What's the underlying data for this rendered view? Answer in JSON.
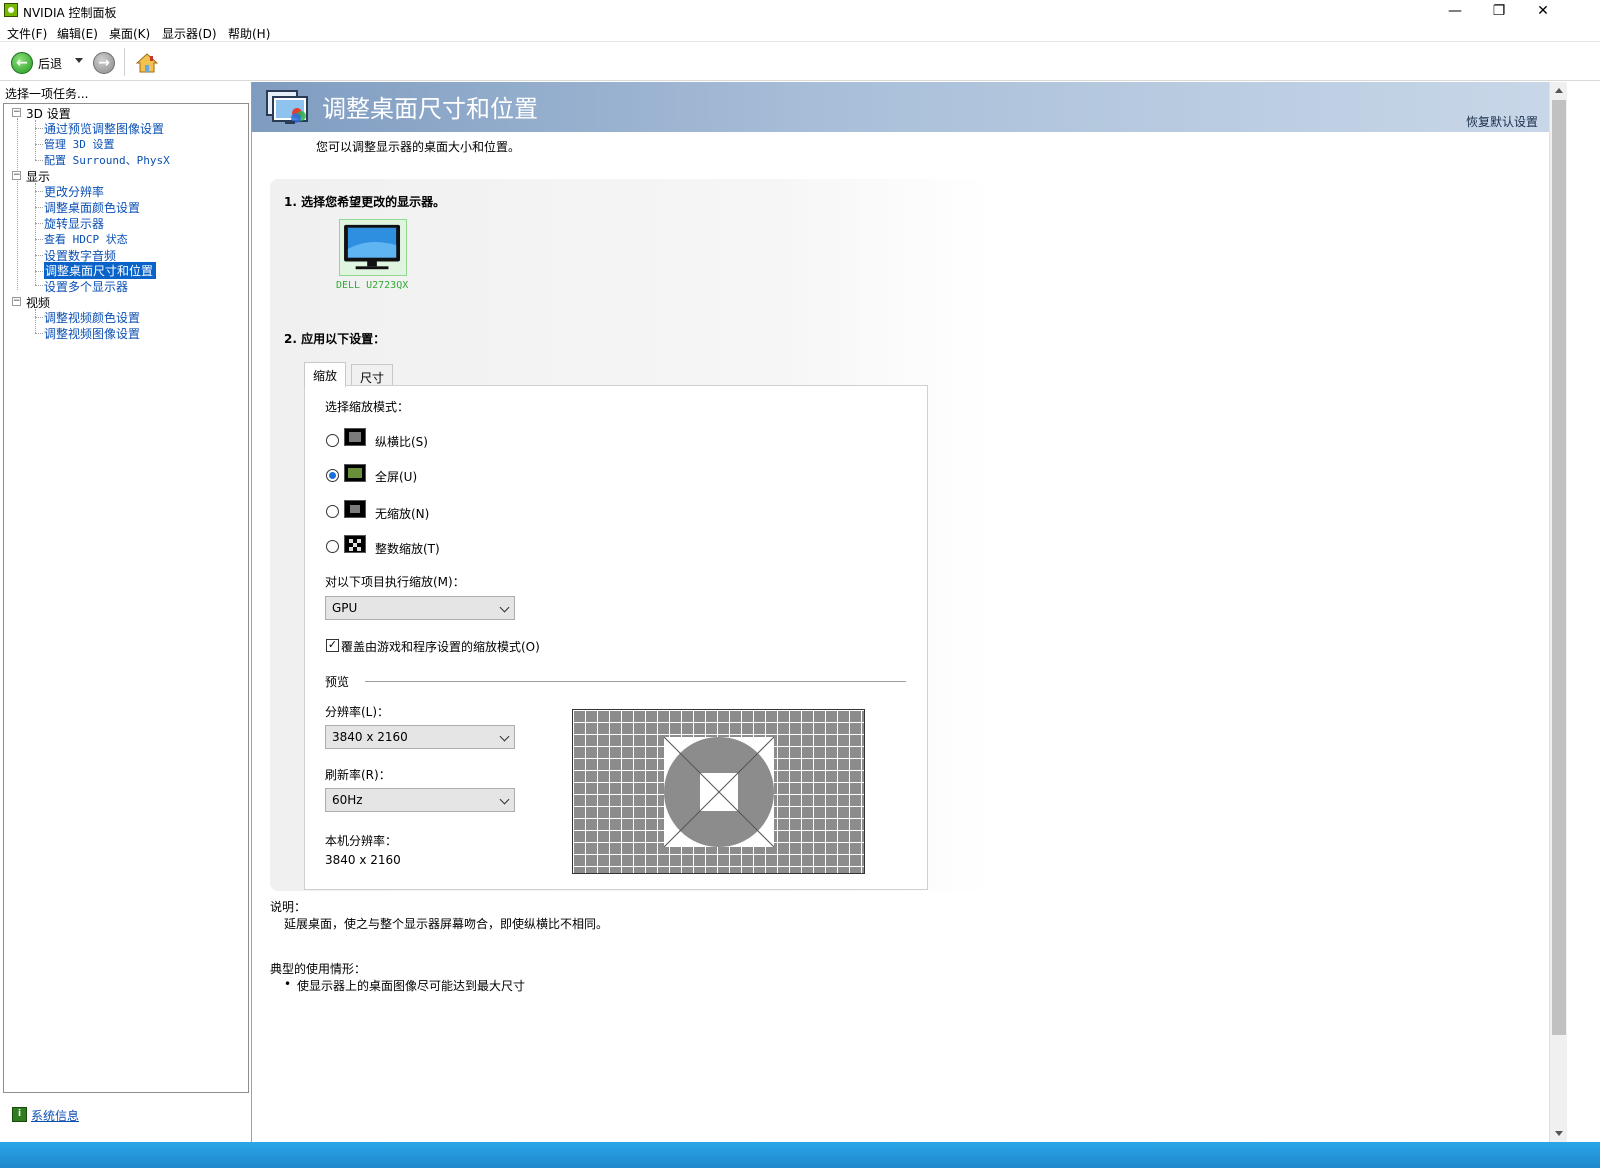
{
  "window": {
    "title": "NVIDIA 控制面板",
    "minimize_glyph": "—",
    "restore_glyph": "❐",
    "close_glyph": "✕"
  },
  "menu": [
    "文件(F)",
    "编辑(E)",
    "桌面(K)",
    "显示器(D)",
    "帮助(H)"
  ],
  "toolbar": {
    "back_label": "后退"
  },
  "sidebar": {
    "header": "选择一项任务...",
    "categories": [
      {
        "label": "3D 设置",
        "items": [
          "通过预览调整图像设置",
          "管理 3D 设置",
          "配置 Surround、PhysX"
        ]
      },
      {
        "label": "显示",
        "items": [
          "更改分辨率",
          "调整桌面颜色设置",
          "旋转显示器",
          "查看 HDCP 状态",
          "设置数字音频",
          "调整桌面尺寸和位置",
          "设置多个显示器"
        ]
      },
      {
        "label": "视频",
        "items": [
          "调整视频颜色设置",
          "调整视频图像设置"
        ]
      }
    ],
    "selected_item": "调整桌面尺寸和位置",
    "system_info_label": "系统信息"
  },
  "page": {
    "title": "调整桌面尺寸和位置",
    "restore_defaults": "恢复默认设置",
    "description": "您可以调整显示器的桌面大小和位置。",
    "step1": "1. 选择您希望更改的显示器。",
    "monitor_name": "DELL U2723QX",
    "step2": "2. 应用以下设置：",
    "tabs": [
      "缩放",
      "尺寸"
    ],
    "active_tab": "缩放",
    "scaling": {
      "mode_label": "选择缩放模式：",
      "modes": [
        {
          "label": "纵横比(S)",
          "checked": false
        },
        {
          "label": "全屏(U)",
          "checked": true
        },
        {
          "label": "无缩放(N)",
          "checked": false
        },
        {
          "label": "整数缩放(T)",
          "checked": false
        }
      ],
      "perform_on_label": "对以下项目执行缩放(M)：",
      "perform_on_value": "GPU",
      "override_label": "覆盖由游戏和程序设置的缩放模式(O)",
      "override_checked": true,
      "preview_label": "预览",
      "resolution_label": "分辨率(L)：",
      "resolution_value": "3840 x 2160",
      "refresh_label": "刷新率(R)：",
      "refresh_value": "60Hz",
      "native_label": "本机分辨率：",
      "native_value": "3840 x 2160"
    },
    "notes": {
      "desc_title": "说明：",
      "desc_text": "延展桌面，使之与整个显示器屏幕吻合，即使纵横比不相同。",
      "usage_title": "典型的使用情形：",
      "usage_bullet": "•",
      "usage_text": "使显示器上的桌面图像尽可能达到最大尺寸"
    }
  },
  "colors": {
    "link": "#0b4fb3",
    "selection": "#0a63c9",
    "banner_left": "#7f9cc0",
    "nvidia_green": "#76b900"
  }
}
